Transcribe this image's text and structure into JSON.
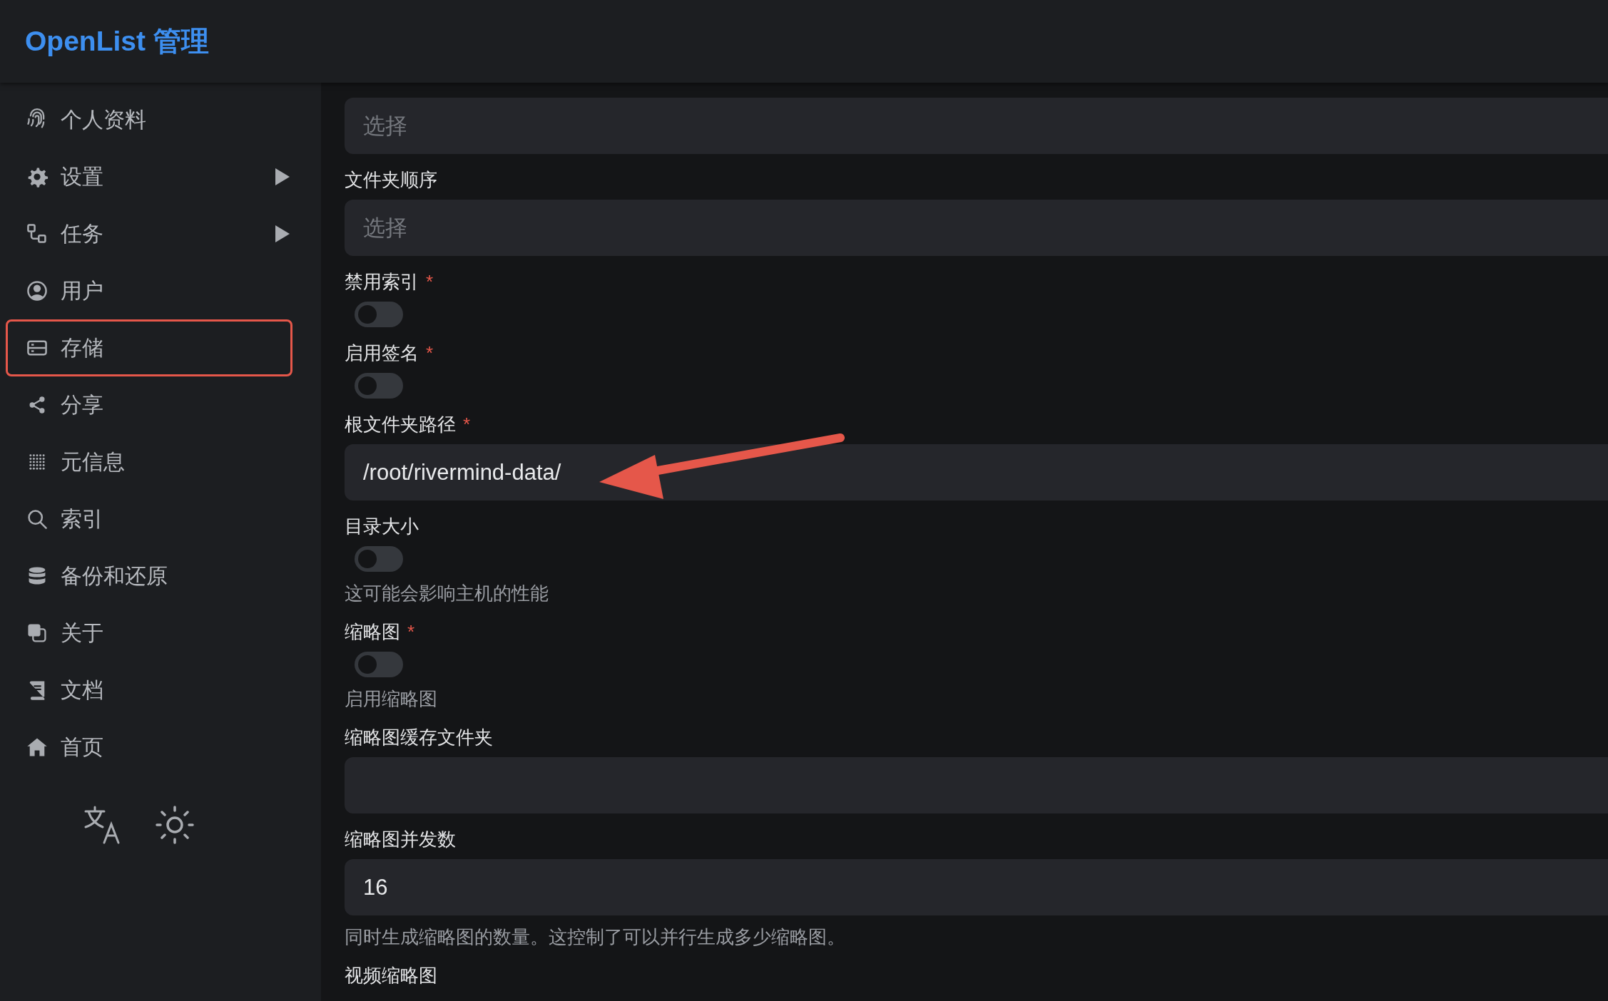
{
  "header": {
    "title": "OpenList 管理"
  },
  "sidebar": {
    "items": [
      {
        "label": "个人资料",
        "expandable": false,
        "highlighted": false
      },
      {
        "label": "设置",
        "expandable": true,
        "highlighted": false
      },
      {
        "label": "任务",
        "expandable": true,
        "highlighted": false
      },
      {
        "label": "用户",
        "expandable": false,
        "highlighted": false
      },
      {
        "label": "存储",
        "expandable": false,
        "highlighted": true
      },
      {
        "label": "分享",
        "expandable": false,
        "highlighted": false
      },
      {
        "label": "元信息",
        "expandable": false,
        "highlighted": false
      },
      {
        "label": "索引",
        "expandable": false,
        "highlighted": false
      },
      {
        "label": "备份和还原",
        "expandable": false,
        "highlighted": false
      },
      {
        "label": "关于",
        "expandable": false,
        "highlighted": false
      },
      {
        "label": "文档",
        "expandable": false,
        "highlighted": false
      },
      {
        "label": "首页",
        "expandable": false,
        "highlighted": false
      }
    ]
  },
  "form": {
    "fields": [
      {
        "kind": "select",
        "placeholder": "选择"
      },
      {
        "kind": "select",
        "label": "文件夹顺序",
        "placeholder": "选择"
      },
      {
        "kind": "switch",
        "label": "禁用索引",
        "required_mark": "*",
        "on": false
      },
      {
        "kind": "switch",
        "label": "启用签名",
        "required_mark": "*",
        "on": false
      },
      {
        "kind": "text",
        "label": "根文件夹路径",
        "required_mark": "*",
        "value": "/root/rivermind-data/"
      },
      {
        "kind": "switch",
        "label": "目录大小",
        "on": false,
        "hint": "这可能会影响主机的性能"
      },
      {
        "kind": "switch",
        "label": "缩略图",
        "required_mark": "*",
        "on": false,
        "hint": "启用缩略图"
      },
      {
        "kind": "text",
        "label": "缩略图缓存文件夹"
      },
      {
        "kind": "text",
        "label": "缩略图并发数",
        "value": "16",
        "hint": "同时生成缩略图的数量。这控制了可以并行生成多少缩略图。"
      },
      {
        "kind": "label",
        "label": "视频缩略图"
      }
    ]
  }
}
